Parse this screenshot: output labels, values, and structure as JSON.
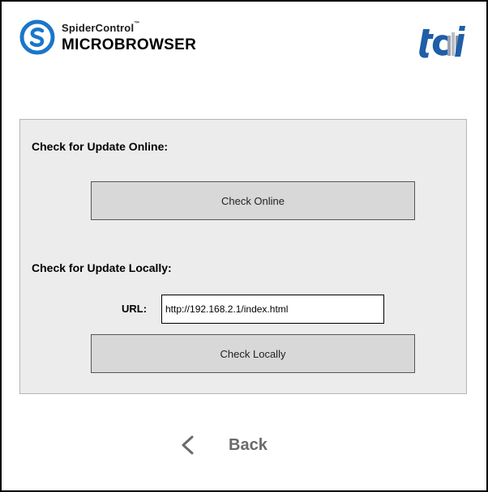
{
  "header": {
    "brand_top": "SpiderControl",
    "brand_tm": "™",
    "brand_bottom": "MICROBROWSER",
    "brand_logo_icon": "spidercontrol-s-logo-icon",
    "partner_logo_icon": "tci-logo"
  },
  "online": {
    "title": "Check for Update Online:",
    "button_label": "Check Online"
  },
  "local": {
    "title": "Check for Update Locally:",
    "url_label": "URL:",
    "url_value": "http://192.168.2.1/index.html",
    "button_label": "Check Locally"
  },
  "nav": {
    "back_label": "Back",
    "back_icon": "chevron-left-icon"
  },
  "colors": {
    "brand_blue": "#1a76c9",
    "tci_blue": "#1f5ea8",
    "panel_bg": "#ececec",
    "button_bg": "#d8d8d8",
    "back_text": "#6a6a6a"
  }
}
